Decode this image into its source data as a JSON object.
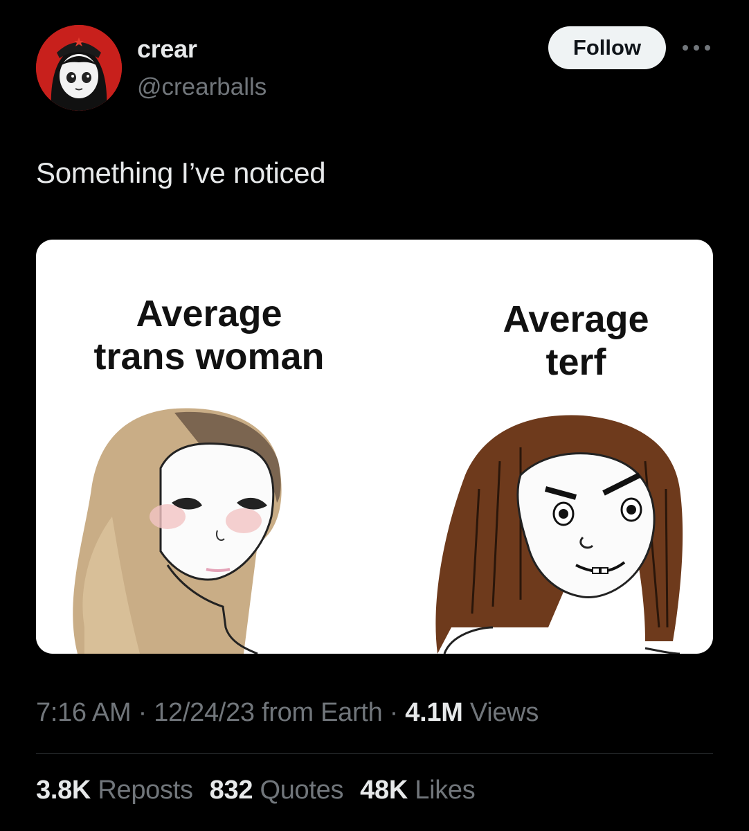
{
  "user": {
    "display_name": "crear",
    "handle": "@crearballs"
  },
  "follow_label": "Follow",
  "tweet": {
    "text": "Something I’ve noticed"
  },
  "meme": {
    "left_caption_line1": "Average",
    "left_caption_line2": "trans woman",
    "right_caption_line1": "Average",
    "right_caption_line2": "terf"
  },
  "meta": {
    "time": "7:16 AM",
    "date": "12/24/23",
    "source": "from Earth",
    "views_count": "4.1M",
    "views_label": "Views",
    "sep": "·"
  },
  "stats": {
    "reposts_count": "3.8K",
    "reposts_label": "Reposts",
    "quotes_count": "832",
    "quotes_label": "Quotes",
    "likes_count": "48K",
    "likes_label": "Likes"
  },
  "colors": {
    "background": "#000000",
    "text": "#e7e9ea",
    "muted": "#71767b",
    "avatar_bg": "#c8201c",
    "follow_bg": "#eff3f4"
  }
}
